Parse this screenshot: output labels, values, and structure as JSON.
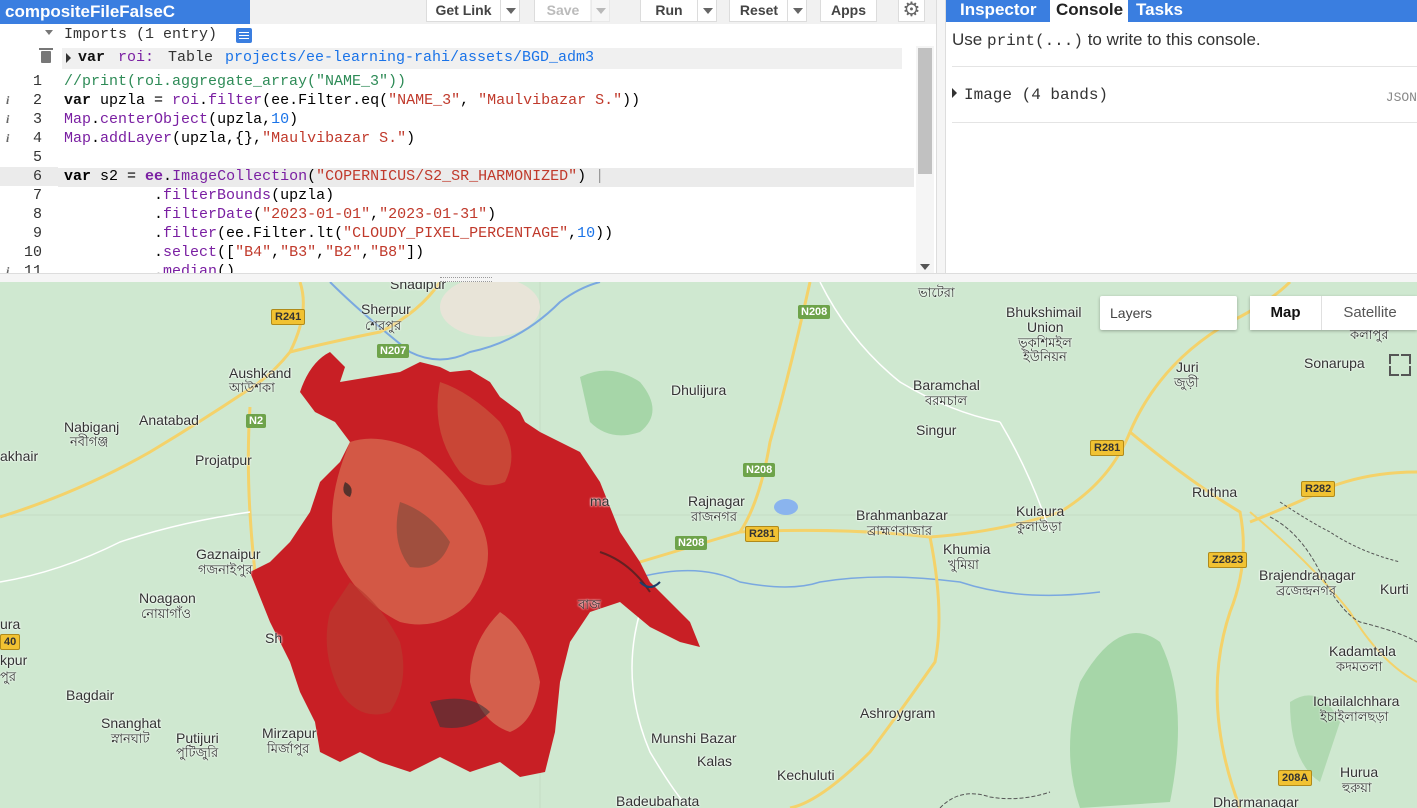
{
  "toolbar": {
    "file_title": "compositeFileFalseC",
    "get_link_label": "Get Link",
    "save_label": "Save",
    "run_label": "Run",
    "reset_label": "Reset",
    "apps_label": "Apps"
  },
  "editor": {
    "imports_label": "Imports (1 entry)",
    "import_var": {
      "keyword": "var",
      "name": "roi",
      "type": "Table",
      "path": "projects/ee-learning-rahi/assets/BGD_adm3"
    },
    "line_numbers": [
      "1",
      "2",
      "3",
      "4",
      "5",
      "6",
      "7",
      "8",
      "9",
      "10",
      "11"
    ]
  },
  "right_panel": {
    "tabs": [
      "Inspector",
      "Console",
      "Tasks"
    ],
    "active_tab": "Console",
    "hint_prefix": "Use ",
    "hint_code": "print(...)",
    "hint_suffix": " to write to this console.",
    "output_item": "Image (4 bands)",
    "json_label": "JSON"
  },
  "map": {
    "layers_label": "Layers",
    "map_type_map": "Map",
    "map_type_satellite": "Satellite",
    "labels": {
      "shadipur": "Shadipur",
      "sherpur": "Sherpur",
      "sherpur_bn": "শেরপুর",
      "aushkandi": "Aushkand",
      "aushkandi_bn": "আউশকা",
      "nabiganj": "Nabiganj",
      "nabiganj_bn": "নবীগঞ্জ",
      "anatabad": "Anatabad",
      "akhair": "akhair",
      "projatpur": "Projatpur",
      "dhulijura": "Dhulijura",
      "baramchal": "Baramchal",
      "baramchal_bn": "বরমচাল",
      "singur": "Singur",
      "bhukshimail": "Bhukshimail",
      "union": "Union",
      "bhukshimail_bn": "ভূকশিমইল",
      "union_bn": "ইউনিয়ন",
      "bhatera_bn": "ভাটেরা",
      "juri": "Juri",
      "juri_bn": "জুড়ী",
      "sonarupa": "Sonarupa",
      "kalapur_bn": "কলাপুর",
      "rajnagar": "Rajnagar",
      "rajnagar_bn": "রাজনগর",
      "brahmanbazar": "Brahmanbazar",
      "brahmanbazar_bn": "ব্রাহ্মণবাজার",
      "khumia": "Khumia",
      "khumia_bn": "খুমিয়া",
      "kulaura": "Kulaura",
      "kulaura_bn": "কুলাউড়া",
      "ruthna": "Ruthna",
      "gaznaipur": "Gaznaipur",
      "gaznaipur_bn": "গজনাইপুর",
      "noagaon": "Noagaon",
      "noagaon_bn": "নোয়াগাঁও",
      "bagdair": "Bagdair",
      "snanghat": "Snanghat",
      "snanghat_bn": "স্নানঘাট",
      "putijuri": "Putijuri",
      "putijuri_bn": "পুটিজুরি",
      "mirzapur": "Mirzapur",
      "mirzapur_bn": "মির্জাপুর",
      "ashroygram": "Ashroygram",
      "munshi_bazar": "Munshi Bazar",
      "kalas": "Kalas",
      "kechuluti": "Kechuluti",
      "badeubahata": "Badeubahata",
      "dharmanagar": "Dharmanagar",
      "brajendranagar": "Brajendranagar",
      "brajendranagar_bn": "ব্রজেন্দ্রনগর",
      "kurti": "Kurti",
      "kadamtala": "Kadamtala",
      "kadamtala_bn": "কদমতলা",
      "ichailalchhara": "Ichailalchhara",
      "ichailalchhara_bn": "ইচাইলালছড়া",
      "hurua": "Hurua",
      "hurua_bn": "হুরুয়া",
      "ura": "ura",
      "kpur": "kpur",
      "kpur_bn": "পুর",
      "sh": "Sh",
      "ma": "ma",
      "baj": "বাজ"
    },
    "road_shields": {
      "r241": "R241",
      "n207": "N207",
      "n2": "N2",
      "n208_top": "N208",
      "n208_mid": "N208",
      "n208_low": "N208",
      "r281_a": "R281",
      "r281_b": "R281",
      "r282": "R282",
      "z2823": "Z2823",
      "r208a": "208A",
      "r40": "40"
    }
  }
}
